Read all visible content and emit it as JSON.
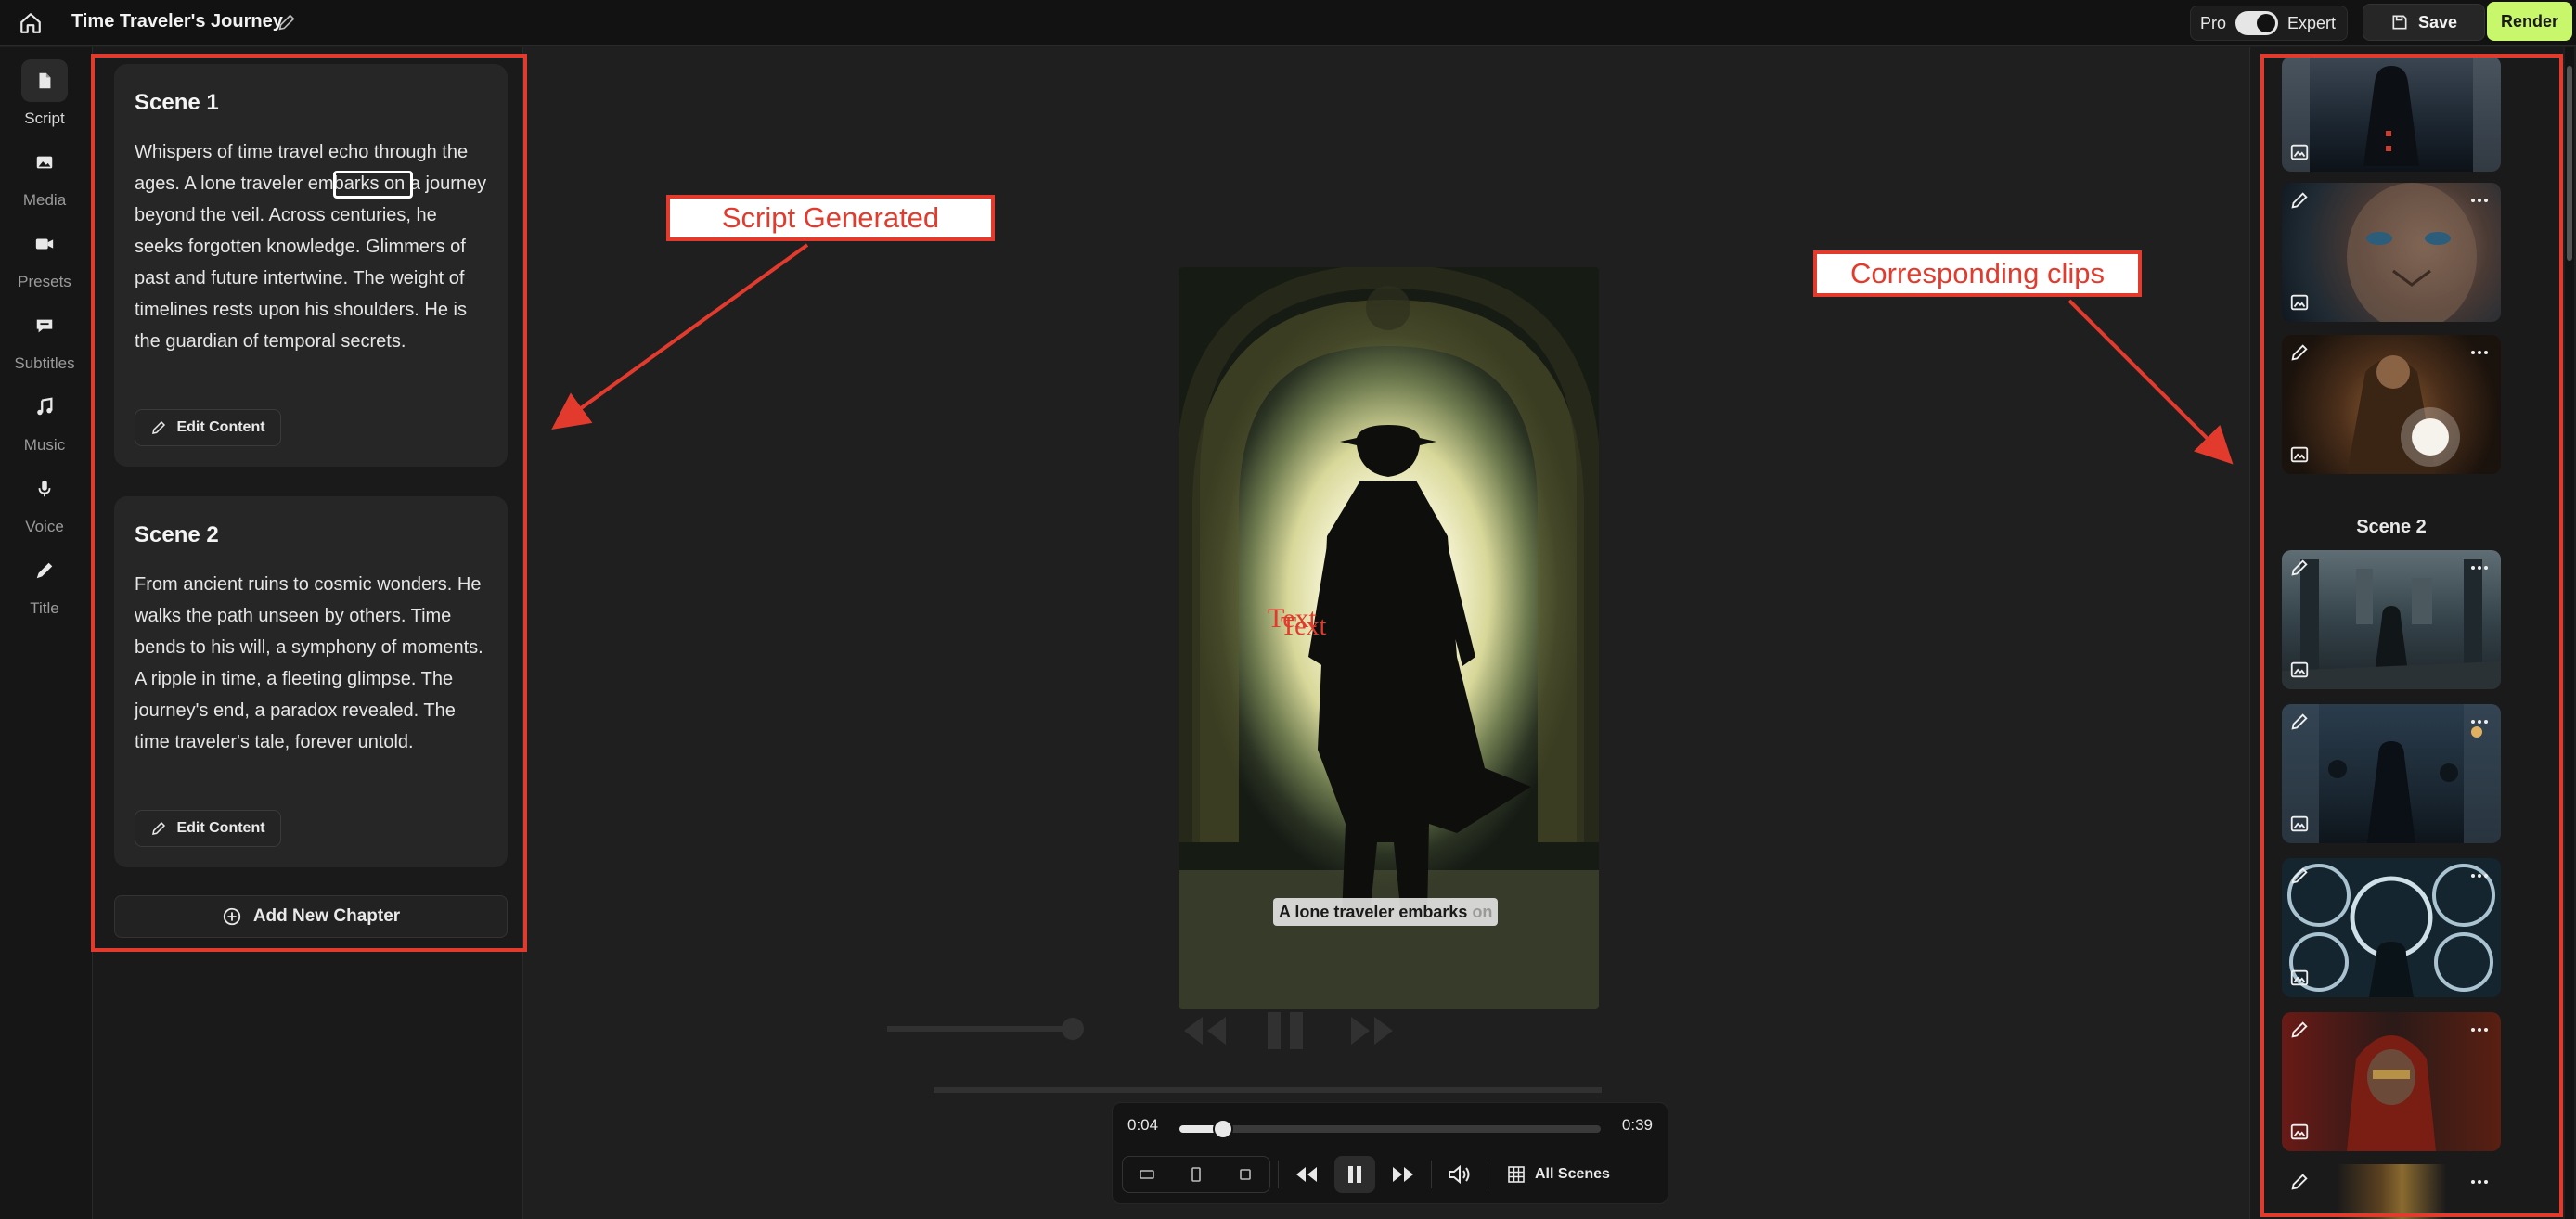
{
  "topbar": {
    "project_title": "Time Traveler's Journey",
    "mode_left": "Pro",
    "mode_right": "Expert",
    "save_label": "Save",
    "render_label": "Render"
  },
  "rail": {
    "items": [
      {
        "label": "Script",
        "icon": "script-icon"
      },
      {
        "label": "Media",
        "icon": "image-icon"
      },
      {
        "label": "Presets",
        "icon": "camera-icon"
      },
      {
        "label": "Subtitles",
        "icon": "chat-icon"
      },
      {
        "label": "Music",
        "icon": "music-note-icon"
      },
      {
        "label": "Voice",
        "icon": "microphone-icon"
      },
      {
        "label": "Title",
        "icon": "pen-icon"
      }
    ]
  },
  "script": {
    "scenes": [
      {
        "title": "Scene 1",
        "text": "Whispers of time travel echo through the ages. A lone traveler embarks on a journey beyond the veil. Across centuries, he seeks forgotten knowledge. Glimmers of past and future intertwine. The weight of timelines rests upon his shoulders. He is the guardian of temporal secrets.",
        "edit_label": "Edit Content"
      },
      {
        "title": "Scene 2",
        "text": "From ancient ruins to cosmic wonders. He walks the path unseen by others. Time bends to his will, a symphony of moments. A ripple in time, a fleeting glimpse. The journey's end, a paradox revealed. The time traveler's tale, forever untold.",
        "edit_label": "Edit Content"
      }
    ],
    "add_chapter_label": "Add New Chapter"
  },
  "preview": {
    "overlay_text_1": "Text",
    "overlay_text_2": "Text",
    "caption_main": "A lone traveler embarks",
    "caption_dim": "on"
  },
  "player": {
    "current_time": "0:04",
    "total_time": "0:39",
    "progress": 0.1026,
    "all_scenes_label": "All Scenes"
  },
  "clips": {
    "scene2_label": "Scene 2"
  },
  "annotations": {
    "script_generated": "Script Generated",
    "corresponding_clips": "Corresponding clips",
    "color": "#e23b2e"
  }
}
